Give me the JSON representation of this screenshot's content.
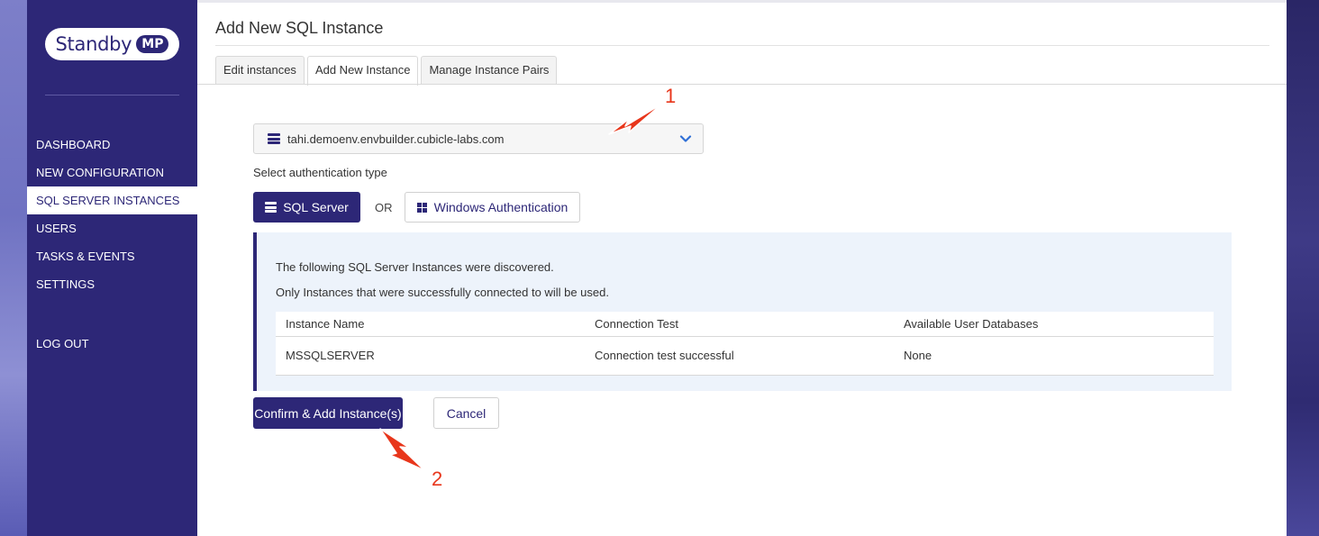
{
  "app": {
    "logo_text": "Standby",
    "logo_badge": "MP"
  },
  "sidebar": {
    "items": [
      {
        "label": "DASHBOARD"
      },
      {
        "label": "NEW CONFIGURATION"
      },
      {
        "label": "SQL SERVER INSTANCES",
        "active": true
      },
      {
        "label": "USERS"
      },
      {
        "label": "TASKS & EVENTS"
      },
      {
        "label": "SETTINGS"
      }
    ],
    "logout_label": "LOG OUT"
  },
  "page": {
    "title": "Add New SQL Instance",
    "tabs": [
      {
        "label": "Edit instances"
      },
      {
        "label": "Add New Instance",
        "active": true
      },
      {
        "label": "Manage Instance Pairs"
      }
    ]
  },
  "form": {
    "instance_select_value": "tahi.demoenv.envbuilder.cubicle-labs.com",
    "auth_label": "Select authentication type",
    "auth_sql_label": "SQL Server",
    "auth_or": "OR",
    "auth_windows_label": "Windows Authentication"
  },
  "discovery": {
    "line1": "The following SQL Server Instances were discovered.",
    "line2": "Only Instances that were successfully connected to will be used.",
    "columns": [
      "Instance Name",
      "Connection Test",
      "Available User Databases"
    ],
    "rows": [
      [
        "MSSQLSERVER",
        "Connection test successful",
        "None"
      ]
    ]
  },
  "actions": {
    "confirm_label": "Confirm & Add Instance(s)",
    "cancel_label": "Cancel"
  },
  "annotations": {
    "marker1": "1",
    "marker2": "2"
  },
  "colors": {
    "brand": "#2d2777",
    "panel_bg": "#edf3fb",
    "annotation": "#e8361b"
  }
}
